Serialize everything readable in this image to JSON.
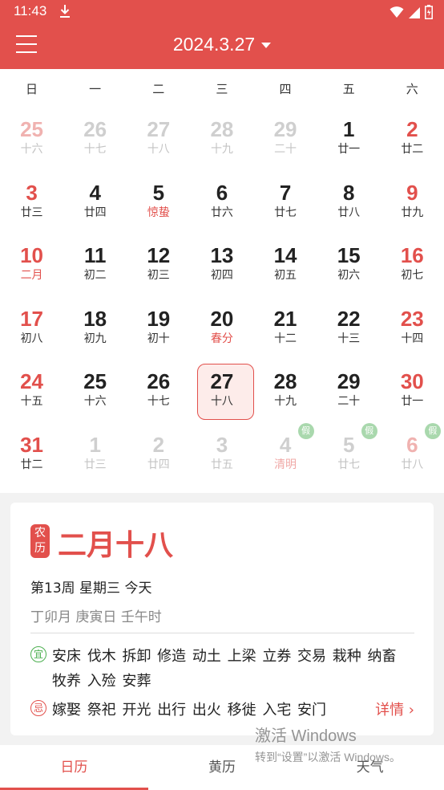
{
  "status_bar": {
    "time": "11:43"
  },
  "header": {
    "date": "2024.3.27"
  },
  "weekdays": [
    "日",
    "一",
    "二",
    "三",
    "四",
    "五",
    "六"
  ],
  "holiday_badge_label": "假",
  "days": [
    {
      "num": "25",
      "lunar": "十六",
      "other": true,
      "weekend": true
    },
    {
      "num": "26",
      "lunar": "十七",
      "other": true
    },
    {
      "num": "27",
      "lunar": "十八",
      "other": true
    },
    {
      "num": "28",
      "lunar": "十九",
      "other": true
    },
    {
      "num": "29",
      "lunar": "二十",
      "other": true
    },
    {
      "num": "1",
      "lunar": "廿一"
    },
    {
      "num": "2",
      "lunar": "廿二",
      "weekend": true
    },
    {
      "num": "3",
      "lunar": "廿三",
      "weekend": true
    },
    {
      "num": "4",
      "lunar": "廿四"
    },
    {
      "num": "5",
      "lunar": "惊蛰",
      "term": true
    },
    {
      "num": "6",
      "lunar": "廿六"
    },
    {
      "num": "7",
      "lunar": "廿七"
    },
    {
      "num": "8",
      "lunar": "廿八"
    },
    {
      "num": "9",
      "lunar": "廿九",
      "weekend": true
    },
    {
      "num": "10",
      "lunar": "二月",
      "weekend": true,
      "term": true
    },
    {
      "num": "11",
      "lunar": "初二"
    },
    {
      "num": "12",
      "lunar": "初三"
    },
    {
      "num": "13",
      "lunar": "初四"
    },
    {
      "num": "14",
      "lunar": "初五"
    },
    {
      "num": "15",
      "lunar": "初六"
    },
    {
      "num": "16",
      "lunar": "初七",
      "weekend": true
    },
    {
      "num": "17",
      "lunar": "初八",
      "weekend": true
    },
    {
      "num": "18",
      "lunar": "初九"
    },
    {
      "num": "19",
      "lunar": "初十"
    },
    {
      "num": "20",
      "lunar": "春分",
      "term": true
    },
    {
      "num": "21",
      "lunar": "十二"
    },
    {
      "num": "22",
      "lunar": "十三"
    },
    {
      "num": "23",
      "lunar": "十四",
      "weekend": true
    },
    {
      "num": "24",
      "lunar": "十五",
      "weekend": true
    },
    {
      "num": "25",
      "lunar": "十六"
    },
    {
      "num": "26",
      "lunar": "十七"
    },
    {
      "num": "27",
      "lunar": "十八",
      "selected": true
    },
    {
      "num": "28",
      "lunar": "十九"
    },
    {
      "num": "29",
      "lunar": "二十"
    },
    {
      "num": "30",
      "lunar": "廿一",
      "weekend": true
    },
    {
      "num": "31",
      "lunar": "廿二",
      "weekend": true
    },
    {
      "num": "1",
      "lunar": "廿三",
      "other": true
    },
    {
      "num": "2",
      "lunar": "廿四",
      "other": true
    },
    {
      "num": "3",
      "lunar": "廿五",
      "other": true
    },
    {
      "num": "4",
      "lunar": "清明",
      "other": true,
      "term": true,
      "holiday": true
    },
    {
      "num": "5",
      "lunar": "廿七",
      "other": true,
      "holiday": true
    },
    {
      "num": "6",
      "lunar": "廿八",
      "other": true,
      "weekend": true,
      "holiday": true
    }
  ],
  "info": {
    "lunar_badge_top": "农",
    "lunar_badge_bottom": "历",
    "lunar_date": "二月十八",
    "week_info": "第13周 星期三 今天",
    "ganzhi": "丁卯月 庚寅日 壬午时",
    "yi_label": "宜",
    "yi_activities": "安床 伐木 拆卸 修造 动土 上梁 立券 交易 栽种 纳畜 牧养 入殓 安葬",
    "ji_label": "忌",
    "ji_activities": "嫁娶 祭祀 开光 出行 出火 移徙 入宅 安门",
    "details_label": "详情 ›"
  },
  "nav": {
    "tabs": [
      "日历",
      "黄历",
      "天气"
    ],
    "active": 0
  },
  "watermark": {
    "title": "激活 Windows",
    "subtitle": "转到“设置”以激活 Windows。"
  },
  "colors": {
    "accent": "#e2504c",
    "holiday_badge": "#a9d8ad",
    "yi": "#4caf50"
  }
}
